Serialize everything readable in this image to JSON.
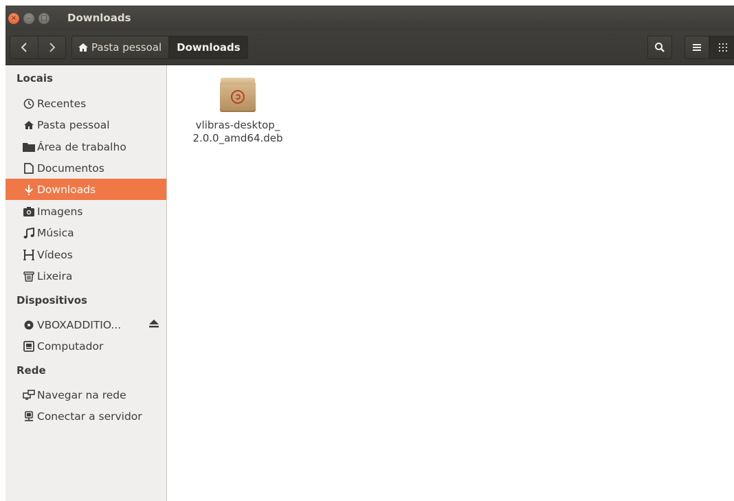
{
  "window": {
    "title": "Downloads",
    "controls": {
      "close": "×",
      "minimize": "–",
      "maximize": "□"
    }
  },
  "toolbar": {
    "back": "‹",
    "forward": "›",
    "breadcrumbs": [
      {
        "label": "Pasta pessoal",
        "icon": "home-icon"
      },
      {
        "label": "Downloads",
        "active": true
      }
    ],
    "search_icon": "search-icon",
    "view_list_icon": "list-view-icon",
    "view_grid_icon": "grid-view-icon"
  },
  "sidebar": {
    "sections": [
      {
        "title": "Locais",
        "items": [
          {
            "label": "Recentes",
            "icon": "clock-icon",
            "glyph": "⏲"
          },
          {
            "label": "Pasta pessoal",
            "icon": "home-icon",
            "glyph": "⌂"
          },
          {
            "label": "Área de trabalho",
            "icon": "desktop-folder-icon",
            "glyph": "▬"
          },
          {
            "label": "Documentos",
            "icon": "document-icon",
            "glyph": "▯"
          },
          {
            "label": "Downloads",
            "icon": "download-icon",
            "glyph": "⇣",
            "selected": true
          },
          {
            "label": "Imagens",
            "icon": "camera-icon",
            "glyph": "◙"
          },
          {
            "label": "Música",
            "icon": "music-icon",
            "glyph": "♫"
          },
          {
            "label": "Vídeos",
            "icon": "film-icon",
            "glyph": "▦"
          },
          {
            "label": "Lixeira",
            "icon": "trash-icon",
            "glyph": "▥"
          }
        ]
      },
      {
        "title": "Dispositivos",
        "items": [
          {
            "label": "VBOXADDITIO...",
            "icon": "disc-icon",
            "glyph": "◉",
            "eject": "⏏"
          },
          {
            "label": "Computador",
            "icon": "computer-icon",
            "glyph": "▣"
          }
        ]
      },
      {
        "title": "Rede",
        "items": [
          {
            "label": "Navegar na rede",
            "icon": "network-icon",
            "glyph": "⧉"
          },
          {
            "label": "Conectar a servidor",
            "icon": "server-icon",
            "glyph": "⊥"
          }
        ]
      }
    ]
  },
  "files": [
    {
      "name_line1": "vlibras-desktop_",
      "name_line2": "2.0.0_amd64.deb",
      "icon": "debian-package-icon"
    }
  ]
}
